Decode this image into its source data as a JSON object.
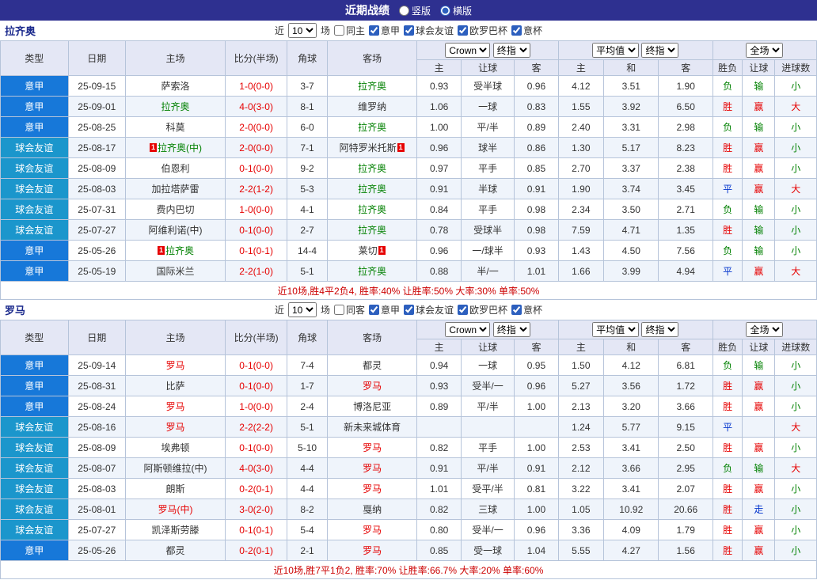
{
  "topbar": {
    "title": "近期战绩",
    "radios": [
      {
        "label": "竖版",
        "checked": false
      },
      {
        "label": "横版",
        "checked": true
      }
    ]
  },
  "type_colors": {
    "意甲": "#1778d9",
    "球会友谊": "#1b96cc"
  },
  "result_colors": {
    "胜": "#e60000",
    "赢": "#e60000",
    "大": "#e60000",
    "负": "#008000",
    "输": "#008000",
    "小": "#008000",
    "平": "#0033cc",
    "走": "#0033cc"
  },
  "sections": [
    {
      "team": "拉齐奥",
      "team_color": "#008000",
      "filter": {
        "near_label": "近",
        "count": "10",
        "games_label": "场",
        "same_label": "同主",
        "same_checked": false,
        "leagues": [
          {
            "label": "意甲",
            "checked": true
          },
          {
            "label": "球会友谊",
            "checked": true
          },
          {
            "label": "欧罗巴杯",
            "checked": true
          },
          {
            "label": "意杯",
            "checked": true
          }
        ]
      },
      "header": {
        "type": "类型",
        "date": "日期",
        "home": "主场",
        "score": "比分(半场)",
        "corner": "角球",
        "away": "客场",
        "ah_book": "Crown",
        "ah_time": "终指",
        "eu_book": "平均值",
        "eu_time": "终指",
        "scope": "全场",
        "sub": [
          "主",
          "让球",
          "客",
          "主",
          "和",
          "客",
          "胜负",
          "让球",
          "进球数"
        ]
      },
      "rows": [
        {
          "type": "意甲",
          "date": "25-09-15",
          "home": "萨索洛",
          "score": "1-0(0-0)",
          "corner": "3-7",
          "away": "拉齐奥",
          "away_hl": true,
          "ah": [
            "0.93",
            "受半球",
            "0.96"
          ],
          "eu": [
            "4.12",
            "3.51",
            "1.90"
          ],
          "res": [
            "负",
            "输",
            "小"
          ]
        },
        {
          "type": "意甲",
          "date": "25-09-01",
          "home": "拉齐奥",
          "home_hl": true,
          "score": "4-0(3-0)",
          "corner": "8-1",
          "away": "维罗纳",
          "ah": [
            "1.06",
            "一球",
            "0.83"
          ],
          "eu": [
            "1.55",
            "3.92",
            "6.50"
          ],
          "res": [
            "胜",
            "赢",
            "大"
          ]
        },
        {
          "type": "意甲",
          "date": "25-08-25",
          "home": "科莫",
          "score": "2-0(0-0)",
          "corner": "6-0",
          "away": "拉齐奥",
          "away_hl": true,
          "ah": [
            "1.00",
            "平/半",
            "0.89"
          ],
          "eu": [
            "2.40",
            "3.31",
            "2.98"
          ],
          "res": [
            "负",
            "输",
            "小"
          ]
        },
        {
          "type": "球会友谊",
          "date": "25-08-17",
          "home": "拉齐奥(中)",
          "home_hl": true,
          "home_card_pre": "1",
          "score": "2-0(0-0)",
          "corner": "7-1",
          "away": "阿特罗米托斯",
          "away_card_post": "1",
          "ah": [
            "0.96",
            "球半",
            "0.86"
          ],
          "eu": [
            "1.30",
            "5.17",
            "8.23"
          ],
          "res": [
            "胜",
            "赢",
            "小"
          ]
        },
        {
          "type": "球会友谊",
          "date": "25-08-09",
          "home": "伯恩利",
          "score": "0-1(0-0)",
          "corner": "9-2",
          "away": "拉齐奥",
          "away_hl": true,
          "ah": [
            "0.97",
            "平手",
            "0.85"
          ],
          "eu": [
            "2.70",
            "3.37",
            "2.38"
          ],
          "res": [
            "胜",
            "赢",
            "小"
          ]
        },
        {
          "type": "球会友谊",
          "date": "25-08-03",
          "home": "加拉塔萨雷",
          "score": "2-2(1-2)",
          "corner": "5-3",
          "away": "拉齐奥",
          "away_hl": true,
          "ah": [
            "0.91",
            "半球",
            "0.91"
          ],
          "eu": [
            "1.90",
            "3.74",
            "3.45"
          ],
          "res": [
            "平",
            "赢",
            "大"
          ]
        },
        {
          "type": "球会友谊",
          "date": "25-07-31",
          "home": "费内巴切",
          "score": "1-0(0-0)",
          "corner": "4-1",
          "away": "拉齐奥",
          "away_hl": true,
          "ah": [
            "0.84",
            "平手",
            "0.98"
          ],
          "eu": [
            "2.34",
            "3.50",
            "2.71"
          ],
          "res": [
            "负",
            "输",
            "小"
          ]
        },
        {
          "type": "球会友谊",
          "date": "25-07-27",
          "home": "阿维利诺(中)",
          "score": "0-1(0-0)",
          "corner": "2-7",
          "away": "拉齐奥",
          "away_hl": true,
          "ah": [
            "0.78",
            "受球半",
            "0.98"
          ],
          "eu": [
            "7.59",
            "4.71",
            "1.35"
          ],
          "res": [
            "胜",
            "输",
            "小"
          ]
        },
        {
          "type": "意甲",
          "date": "25-05-26",
          "home": "拉齐奥",
          "home_hl": true,
          "home_card_pre": "1",
          "score": "0-1(0-1)",
          "corner": "14-4",
          "away": "莱切",
          "away_card_post": "1",
          "ah": [
            "0.96",
            "一/球半",
            "0.93"
          ],
          "eu": [
            "1.43",
            "4.50",
            "7.56"
          ],
          "res": [
            "负",
            "输",
            "小"
          ]
        },
        {
          "type": "意甲",
          "date": "25-05-19",
          "home": "国际米兰",
          "score": "2-2(1-0)",
          "corner": "5-1",
          "away": "拉齐奥",
          "away_hl": true,
          "ah": [
            "0.88",
            "半/一",
            "1.01"
          ],
          "eu": [
            "1.66",
            "3.99",
            "4.94"
          ],
          "res": [
            "平",
            "赢",
            "大"
          ]
        }
      ],
      "footer": "近10场,胜4平2负4, 胜率:40% 让胜率:50% 大率:30% 单率:50%"
    },
    {
      "team": "罗马",
      "team_color": "#e60000",
      "filter": {
        "near_label": "近",
        "count": "10",
        "games_label": "场",
        "same_label": "同客",
        "same_checked": false,
        "leagues": [
          {
            "label": "意甲",
            "checked": true
          },
          {
            "label": "球会友谊",
            "checked": true
          },
          {
            "label": "欧罗巴杯",
            "checked": true
          },
          {
            "label": "意杯",
            "checked": true
          }
        ]
      },
      "header": {
        "type": "类型",
        "date": "日期",
        "home": "主场",
        "score": "比分(半场)",
        "corner": "角球",
        "away": "客场",
        "ah_book": "Crown",
        "ah_time": "终指",
        "eu_book": "平均值",
        "eu_time": "终指",
        "scope": "全场",
        "sub": [
          "主",
          "让球",
          "客",
          "主",
          "和",
          "客",
          "胜负",
          "让球",
          "进球数"
        ]
      },
      "rows": [
        {
          "type": "意甲",
          "date": "25-09-14",
          "home": "罗马",
          "home_hl": true,
          "score": "0-1(0-0)",
          "corner": "7-4",
          "away": "都灵",
          "ah": [
            "0.94",
            "一球",
            "0.95"
          ],
          "eu": [
            "1.50",
            "4.12",
            "6.81"
          ],
          "res": [
            "负",
            "输",
            "小"
          ]
        },
        {
          "type": "意甲",
          "date": "25-08-31",
          "home": "比萨",
          "score": "0-1(0-0)",
          "corner": "1-7",
          "away": "罗马",
          "away_hl": true,
          "ah": [
            "0.93",
            "受半/一",
            "0.96"
          ],
          "eu": [
            "5.27",
            "3.56",
            "1.72"
          ],
          "res": [
            "胜",
            "赢",
            "小"
          ]
        },
        {
          "type": "意甲",
          "date": "25-08-24",
          "home": "罗马",
          "home_hl": true,
          "score": "1-0(0-0)",
          "corner": "2-4",
          "away": "博洛尼亚",
          "ah": [
            "0.89",
            "平/半",
            "1.00"
          ],
          "eu": [
            "2.13",
            "3.20",
            "3.66"
          ],
          "res": [
            "胜",
            "赢",
            "小"
          ]
        },
        {
          "type": "球会友谊",
          "date": "25-08-16",
          "home": "罗马",
          "home_hl": true,
          "score": "2-2(2-2)",
          "corner": "5-1",
          "away": "新未来城体育",
          "ah": [
            "",
            "",
            ""
          ],
          "eu": [
            "1.24",
            "5.77",
            "9.15"
          ],
          "res": [
            "平",
            "",
            "大"
          ]
        },
        {
          "type": "球会友谊",
          "date": "25-08-09",
          "home": "埃弗顿",
          "score": "0-1(0-0)",
          "corner": "5-10",
          "away": "罗马",
          "away_hl": true,
          "ah": [
            "0.82",
            "平手",
            "1.00"
          ],
          "eu": [
            "2.53",
            "3.41",
            "2.50"
          ],
          "res": [
            "胜",
            "赢",
            "小"
          ]
        },
        {
          "type": "球会友谊",
          "date": "25-08-07",
          "home": "阿斯顿维拉(中)",
          "score": "4-0(3-0)",
          "corner": "4-4",
          "away": "罗马",
          "away_hl": true,
          "ah": [
            "0.91",
            "平/半",
            "0.91"
          ],
          "eu": [
            "2.12",
            "3.66",
            "2.95"
          ],
          "res": [
            "负",
            "输",
            "大"
          ]
        },
        {
          "type": "球会友谊",
          "date": "25-08-03",
          "home": "朗斯",
          "score": "0-2(0-1)",
          "corner": "4-4",
          "away": "罗马",
          "away_hl": true,
          "ah": [
            "1.01",
            "受平/半",
            "0.81"
          ],
          "eu": [
            "3.22",
            "3.41",
            "2.07"
          ],
          "res": [
            "胜",
            "赢",
            "小"
          ]
        },
        {
          "type": "球会友谊",
          "date": "25-08-01",
          "home": "罗马(中)",
          "home_hl": true,
          "score": "3-0(2-0)",
          "corner": "8-2",
          "away": "戛纳",
          "ah": [
            "0.82",
            "三球",
            "1.00"
          ],
          "eu": [
            "1.05",
            "10.92",
            "20.66"
          ],
          "res": [
            "胜",
            "走",
            "小"
          ]
        },
        {
          "type": "球会友谊",
          "date": "25-07-27",
          "home": "凯泽斯劳滕",
          "score": "0-1(0-1)",
          "corner": "5-4",
          "away": "罗马",
          "away_hl": true,
          "ah": [
            "0.80",
            "受半/一",
            "0.96"
          ],
          "eu": [
            "3.36",
            "4.09",
            "1.79"
          ],
          "res": [
            "胜",
            "赢",
            "小"
          ]
        },
        {
          "type": "意甲",
          "date": "25-05-26",
          "home": "都灵",
          "score": "0-2(0-1)",
          "corner": "2-1",
          "away": "罗马",
          "away_hl": true,
          "ah": [
            "0.85",
            "受一球",
            "1.04"
          ],
          "eu": [
            "5.55",
            "4.27",
            "1.56"
          ],
          "res": [
            "胜",
            "赢",
            "小"
          ]
        }
      ],
      "footer": "近10场,胜7平1负2, 胜率:70% 让胜率:66.7% 大率:20% 单率:60%"
    }
  ]
}
